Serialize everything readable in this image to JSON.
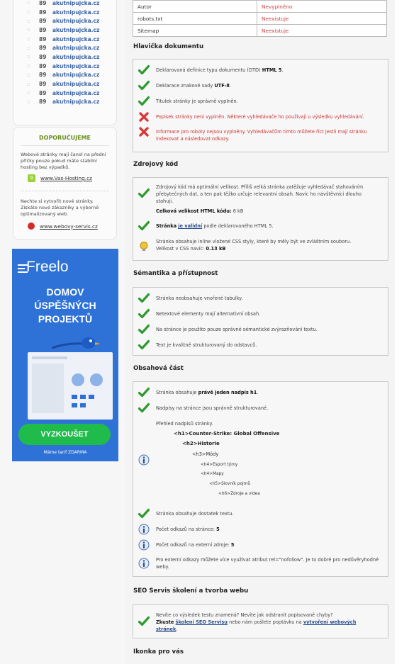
{
  "sidebar": {
    "list_items": [
      {
        "num": "89",
        "site": "akutnipujcka.cz"
      },
      {
        "num": "89",
        "site": "akutnipujcka.cz"
      },
      {
        "num": "89",
        "site": "akutnipujcka.cz"
      },
      {
        "num": "89",
        "site": "akutnipujcka.cz"
      },
      {
        "num": "89",
        "site": "akutnipujcka.cz"
      },
      {
        "num": "89",
        "site": "akutnipujcka.cz"
      },
      {
        "num": "89",
        "site": "akutnipujcka.cz"
      },
      {
        "num": "89",
        "site": "akutnipujcka.cz"
      },
      {
        "num": "89",
        "site": "akutnipujcka.cz"
      },
      {
        "num": "89",
        "site": "akutnipujcka.cz"
      },
      {
        "num": "89",
        "site": "akutnipujcka.cz"
      },
      {
        "num": "89",
        "site": "akutnipujcka.cz"
      }
    ],
    "recommend": {
      "title": "DOPORUČUJEME",
      "hosting_text": "Webové stránky mají čanol na přední příčky pouze pokud máte stabilní hosting bez výpadků.",
      "hosting_link": "www.Vas-Hosting.cz",
      "servis_text": "Nechte si vytvořit nové stránky. Získáte nové zákazníky a výborně optimalizovaný web.",
      "servis_link": "www.webovy-servis.cz"
    },
    "ad": {
      "logo": "Freelo",
      "headline_1": "DOMOV",
      "headline_2": "ÚSPĚŠNÝCH",
      "headline_3": "PROJEKTŮ",
      "button": "VYZKOUŠET",
      "tariff": "Máme tarif ZDARMA"
    }
  },
  "meta_table": [
    {
      "key": "Autor",
      "value": "Nevyplněno"
    },
    {
      "key": "robots.txt",
      "value": "Neexistuje"
    },
    {
      "key": "Sitemap",
      "value": "Neexistuje"
    }
  ],
  "sections": {
    "header": {
      "title": "Hlavička dokumentu",
      "items": [
        {
          "text": "Deklarovaná definice typu dokumentu (DTD)",
          "bold": "HTML 5",
          "tail": "."
        },
        {
          "text": "Deklarace znakové sady",
          "bold": "UTF-8",
          "tail": "."
        },
        {
          "text": "Titulek stránky je správně vyplněn."
        },
        {
          "text": "Popisek stránky není vyplněn. Některé vyhledávače ho používají u výsledku vyhledávání."
        },
        {
          "text": "Informace pro roboty nejsou vyplněny. Vyhledávačům tímto můžete říct jestli mají stránku indexovat a následovat odkazy."
        }
      ]
    },
    "source": {
      "title": "Zdrojový kód",
      "size_text": "Zdrojový kód má optimální velikost. Příliš velká stránka zatěžuje vyhledávač stahováním přebytečných dat, a ten pak těžko určuje relevantní obsah. Navíc ho návštěvníci dlouho stahují.",
      "size_label": "Celková velikost HTML kódu:",
      "size_value": "6 kB",
      "valid_pre": "Stránka",
      "valid_link": "je validní",
      "valid_post": "podle deklarovaného HTML 5.",
      "css_text": "Stránka obsahuje inline vložené CSS styly, které by měly být ve zvláštním souboru.",
      "css_label": "Velikost v CSS navíc:",
      "css_value": "0.13 kB"
    },
    "semantics": {
      "title": "Sémantika a přístupnost",
      "items": [
        "Stránka neobsahuje vnořené tabulky.",
        "Netextové elementy mají alternativní obsah.",
        "Na stránce je použito pouze správné sémantické zvýrazňování textu.",
        "Text je kvalitně strukturovaný do odstavců."
      ]
    },
    "content": {
      "title": "Obsahová část",
      "h1_pre": "Stránka obsahuje",
      "h1_bold": "právě jeden nadpis h1",
      "h1_tail": ".",
      "headings_ok": "Nadpisy na stránce jsou správně strukturované.",
      "overview": "Přehled nadpisů stránky.",
      "tree": [
        {
          "tag": "<h1>",
          "text": "Counter-Strike: Global Offensive"
        },
        {
          "tag": "<h2>",
          "text": "Historie"
        },
        {
          "tag": "<h3>",
          "text": "Módy"
        },
        {
          "tag": "<h4>",
          "text": "Esport týmy"
        },
        {
          "tag": "<h4>",
          "text": "Mapy"
        },
        {
          "tag": "<h5>",
          "text": "Slovník pojmů"
        },
        {
          "tag": "<h6>",
          "text": "Zdroje a videa"
        }
      ],
      "enough_text": "Stránka obsahuje dostatek textu.",
      "links_label": "Počet odkazů na stránce:",
      "links_value": "5",
      "ext_label": "Počet odkazů na externí zdroje:",
      "ext_value": "5",
      "nofollow": "Pro externí odkazy můžete více využívat atribut rel=\"nofollow\". Je to dobré pro nedůvěryhodné weby."
    },
    "seo": {
      "title": "SEO Servis školení a tvorba webu",
      "line1": "Nevíte co výsledek testu znamená? Nevíte jak odstranit popisované chyby?",
      "try": "Zkuste",
      "link1": "školení SEO Servisu",
      "mid": "nebo nám pošlete poptávku na",
      "link2": "vytvoření webových stránek",
      "end": "."
    },
    "icon": {
      "title": "Ikonka pro vás"
    }
  }
}
